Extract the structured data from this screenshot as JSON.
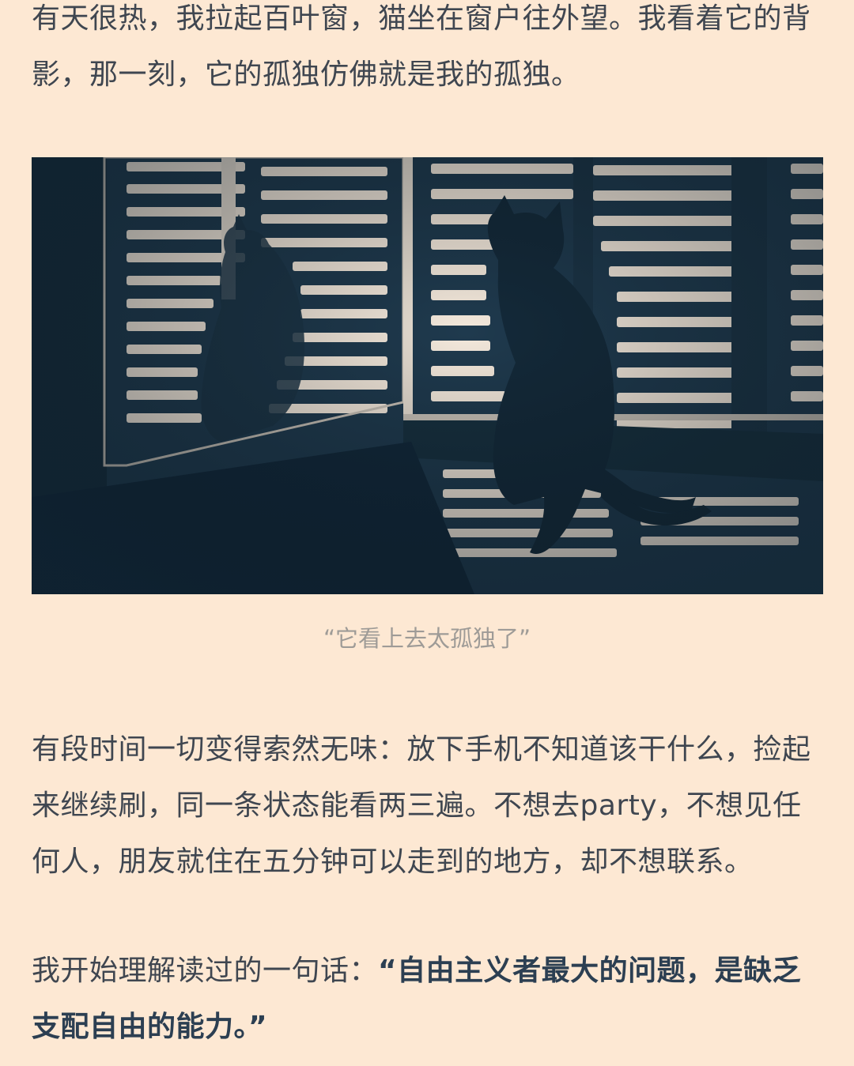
{
  "article": {
    "paragraph_1": "有天很热，我拉起百叶窗，猫坐在窗户往外望。我看着它的背影，那一刻，它的孤独仿佛就是我的孤独。",
    "photo": {
      "subject": "cat-at-window-blinds",
      "tint_dark": "#1f3a4e",
      "tint_light": "#f4e9dc"
    },
    "caption": "“它看上去太孤独了”",
    "paragraph_2": "有段时间一切变得索然无味：放下手机不知道该干什么，捡起来继续刷，同一条状态能看两三遍。不想去party，不想见任何人，朋友就住在五分钟可以走到的地方，却不想联系。",
    "paragraph_3_lead": "我开始理解读过的一句话：",
    "paragraph_3_quote": "“自由主义者最大的问题，是缺乏支配自由的能力。”"
  },
  "colors": {
    "background": "#fde8d3",
    "body_text": "#3f4650",
    "caption_text": "#9e9b97",
    "emphasis_text": "#2c3f52"
  }
}
